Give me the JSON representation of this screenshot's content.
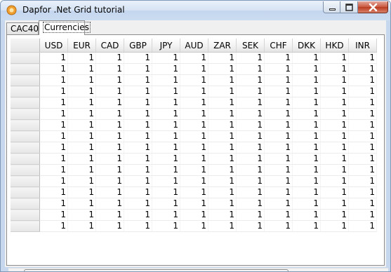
{
  "window": {
    "title": "Dapfor .Net Grid tutorial"
  },
  "titlebar_controls": [
    "minimize-icon",
    "maximize-icon",
    "close-icon"
  ],
  "tabs": [
    {
      "label": "CAC40",
      "active": false
    },
    {
      "label": "Currencies",
      "active": true
    }
  ],
  "grid": {
    "columns": [
      "USD",
      "EUR",
      "CAD",
      "GBP",
      "JPY",
      "AUD",
      "ZAR",
      "SEK",
      "CHF",
      "DKK",
      "HKD",
      "INR"
    ],
    "rows": [
      [
        "1",
        "1",
        "1",
        "1",
        "1",
        "1",
        "1",
        "1",
        "1",
        "1",
        "1",
        "1"
      ],
      [
        "1",
        "1",
        "1",
        "1",
        "1",
        "1",
        "1",
        "1",
        "1",
        "1",
        "1",
        "1"
      ],
      [
        "1",
        "1",
        "1",
        "1",
        "1",
        "1",
        "1",
        "1",
        "1",
        "1",
        "1",
        "1"
      ],
      [
        "1",
        "1",
        "1",
        "1",
        "1",
        "1",
        "1",
        "1",
        "1",
        "1",
        "1",
        "1"
      ],
      [
        "1",
        "1",
        "1",
        "1",
        "1",
        "1",
        "1",
        "1",
        "1",
        "1",
        "1",
        "1"
      ],
      [
        "1",
        "1",
        "1",
        "1",
        "1",
        "1",
        "1",
        "1",
        "1",
        "1",
        "1",
        "1"
      ],
      [
        "1",
        "1",
        "1",
        "1",
        "1",
        "1",
        "1",
        "1",
        "1",
        "1",
        "1",
        "1"
      ],
      [
        "1",
        "1",
        "1",
        "1",
        "1",
        "1",
        "1",
        "1",
        "1",
        "1",
        "1",
        "1"
      ],
      [
        "1",
        "1",
        "1",
        "1",
        "1",
        "1",
        "1",
        "1",
        "1",
        "1",
        "1",
        "1"
      ],
      [
        "1",
        "1",
        "1",
        "1",
        "1",
        "1",
        "1",
        "1",
        "1",
        "1",
        "1",
        "1"
      ],
      [
        "1",
        "1",
        "1",
        "1",
        "1",
        "1",
        "1",
        "1",
        "1",
        "1",
        "1",
        "1"
      ],
      [
        "1",
        "1",
        "1",
        "1",
        "1",
        "1",
        "1",
        "1",
        "1",
        "1",
        "1",
        "1"
      ],
      [
        "1",
        "1",
        "1",
        "1",
        "1",
        "1",
        "1",
        "1",
        "1",
        "1",
        "1",
        "1"
      ],
      [
        "1",
        "1",
        "1",
        "1",
        "1",
        "1",
        "1",
        "1",
        "1",
        "1",
        "1",
        "1"
      ],
      [
        "1",
        "1",
        "1",
        "1",
        "1",
        "1",
        "1",
        "1",
        "1",
        "1",
        "1",
        "1"
      ],
      [
        "1",
        "1",
        "1",
        "1",
        "1",
        "1",
        "1",
        "1",
        "1",
        "1",
        "1",
        "1"
      ]
    ]
  },
  "colors": {
    "close_button": "#c8573f",
    "titlebar": "#c4d6ee"
  }
}
